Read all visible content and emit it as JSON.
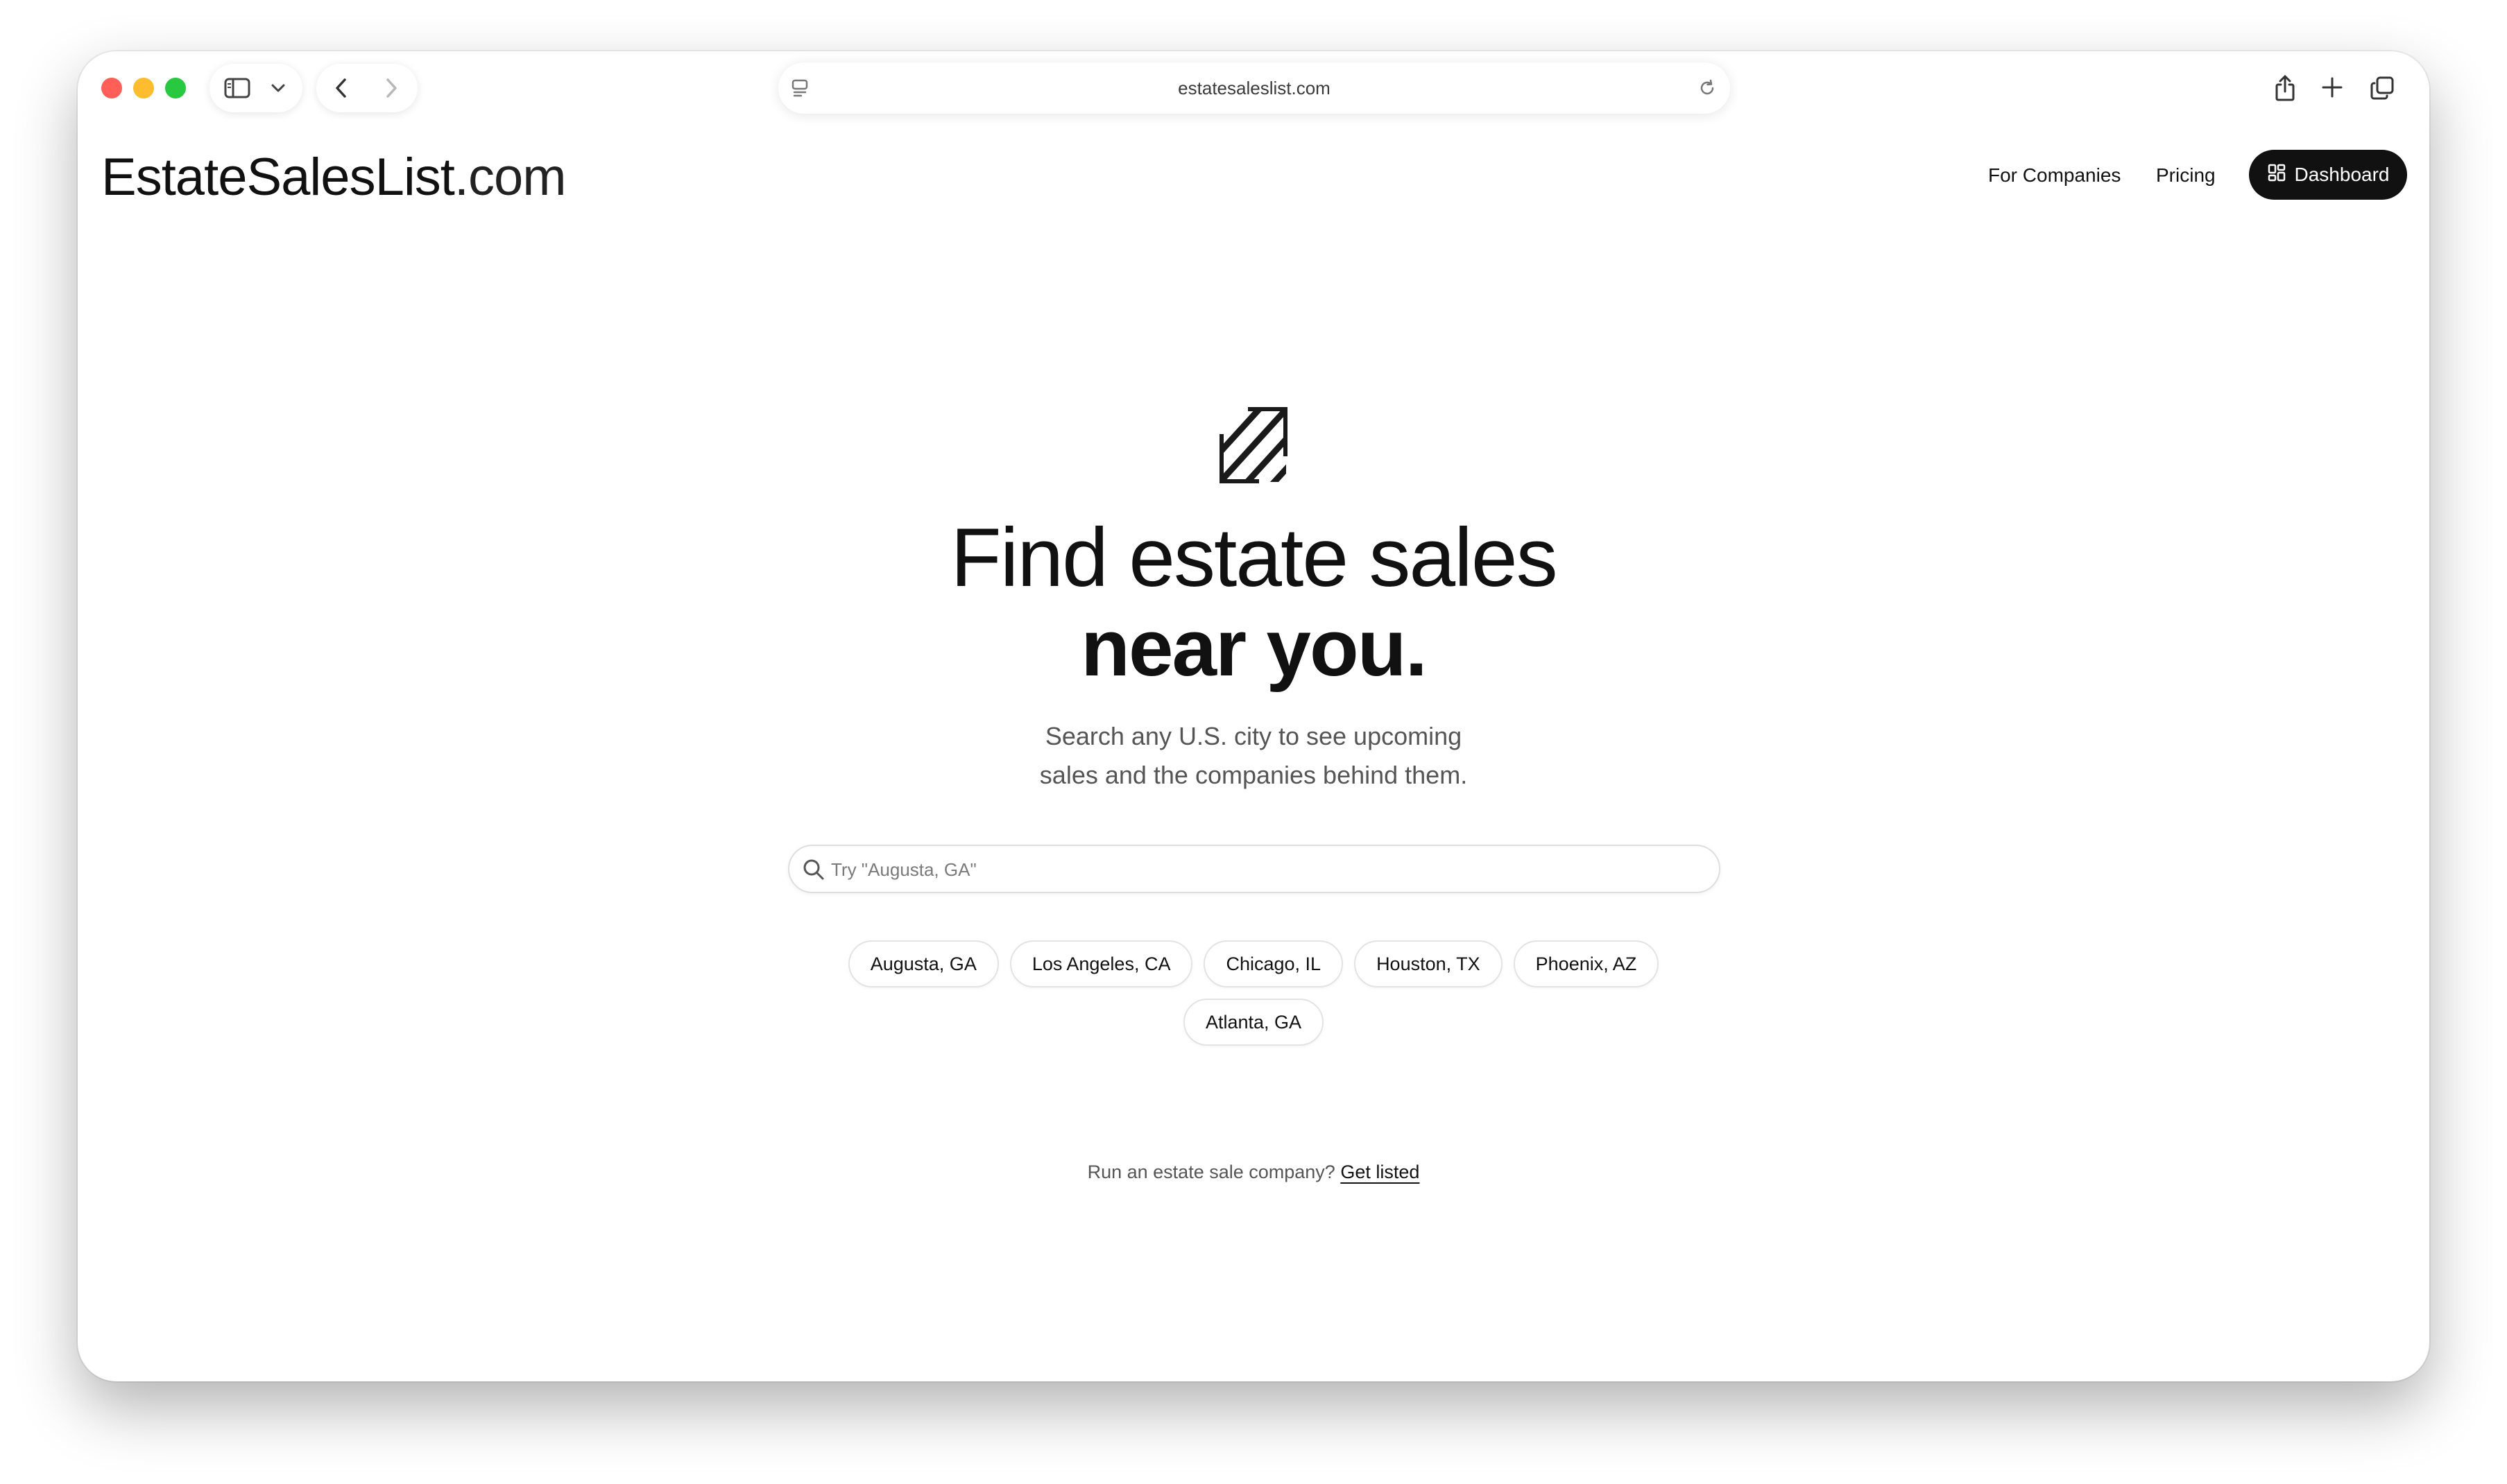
{
  "browser": {
    "url": "estatesaleslist.com",
    "traffic_colors": {
      "close": "#ff5f57",
      "minimize": "#febc2e",
      "zoom": "#28c840"
    }
  },
  "header": {
    "logo_main": "EstateSalesList",
    "logo_suffix": ".com",
    "nav": {
      "for_companies": "For Companies",
      "pricing": "Pricing",
      "dashboard": "Dashboard"
    }
  },
  "hero": {
    "headline_line1": "Find estate sales",
    "headline_line2": "near you.",
    "subtitle_line1": "Search any U.S. city to see upcoming",
    "subtitle_line2": "sales and the companies behind them.",
    "search_placeholder": "Try \"Augusta, GA\"",
    "search_value": ""
  },
  "cities": [
    "Augusta, GA",
    "Los Angeles, CA",
    "Chicago, IL",
    "Houston, TX",
    "Phoenix, AZ",
    "Atlanta, GA"
  ],
  "footer": {
    "cta_text": "Run an estate sale company?",
    "cta_link": "Get listed"
  },
  "colors": {
    "primary": "#111111",
    "muted": "#555555",
    "chip_border": "#e3e3e3"
  },
  "icons": {
    "logo_mark": "striped-square-icon",
    "search": "search-icon",
    "dashboard": "grid-icon"
  }
}
